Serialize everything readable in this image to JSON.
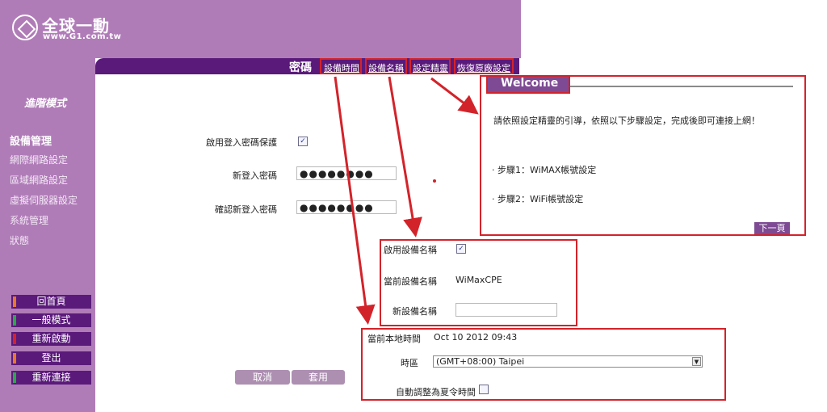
{
  "logo": {
    "title": "全球一動",
    "subtitle": "www.G1.com.tw"
  },
  "header": {
    "page_title": "密碼",
    "links": [
      "設備時間",
      "設備名稱",
      "設定精靈",
      "恢復原廠設定"
    ]
  },
  "sidebar": {
    "mode_title": "進階模式",
    "items": [
      "設備管理",
      "網際網路設定",
      "區域網路設定",
      "虛擬伺服器設定",
      "系統管理",
      "狀態"
    ],
    "buttons": [
      {
        "label": "回首頁",
        "color": "#e8782a"
      },
      {
        "label": "一般模式",
        "color": "#2aa84a"
      },
      {
        "label": "重新啟動",
        "color": "#d3232a"
      },
      {
        "label": "登出",
        "color": "#e8782a"
      },
      {
        "label": "重新連接",
        "color": "#2aa84a"
      }
    ]
  },
  "password_form": {
    "enable_label": "啟用登入密碼保護",
    "enable_checked": "✓",
    "new_label": "新登入密碼",
    "new_value": "●●●●●●●●",
    "confirm_label": "確認新登入密碼",
    "confirm_value": "●●●●●●●●",
    "cancel": "取消",
    "apply": "套用"
  },
  "welcome": {
    "title": "Welcome",
    "intro": "請依照設定精靈的引導，依照以下步驟設定，完成後即可連接上網！",
    "step1": "· 步驟1：WiMAX帳號設定",
    "step2": "· 步驟2：WiFi帳號設定",
    "next": "下一頁"
  },
  "device_name": {
    "enable_label": "啟用設備名稱",
    "enable_checked": "✓",
    "current_label": "當前設備名稱",
    "current_value": "WiMaxCPE",
    "new_label": "新設備名稱",
    "new_value": ""
  },
  "device_time": {
    "local_time_label": "當前本地時間",
    "local_time_value": "Oct 10 2012 09:43",
    "timezone_label": "時區",
    "timezone_value": "(GMT+08:00) Taipei",
    "dst_label": "自動調整為夏令時間",
    "dst_checked": ""
  },
  "colors": {
    "accent": "#5a1a7a",
    "sidebar": "#b07cb8",
    "highlight": "#d3232a"
  }
}
